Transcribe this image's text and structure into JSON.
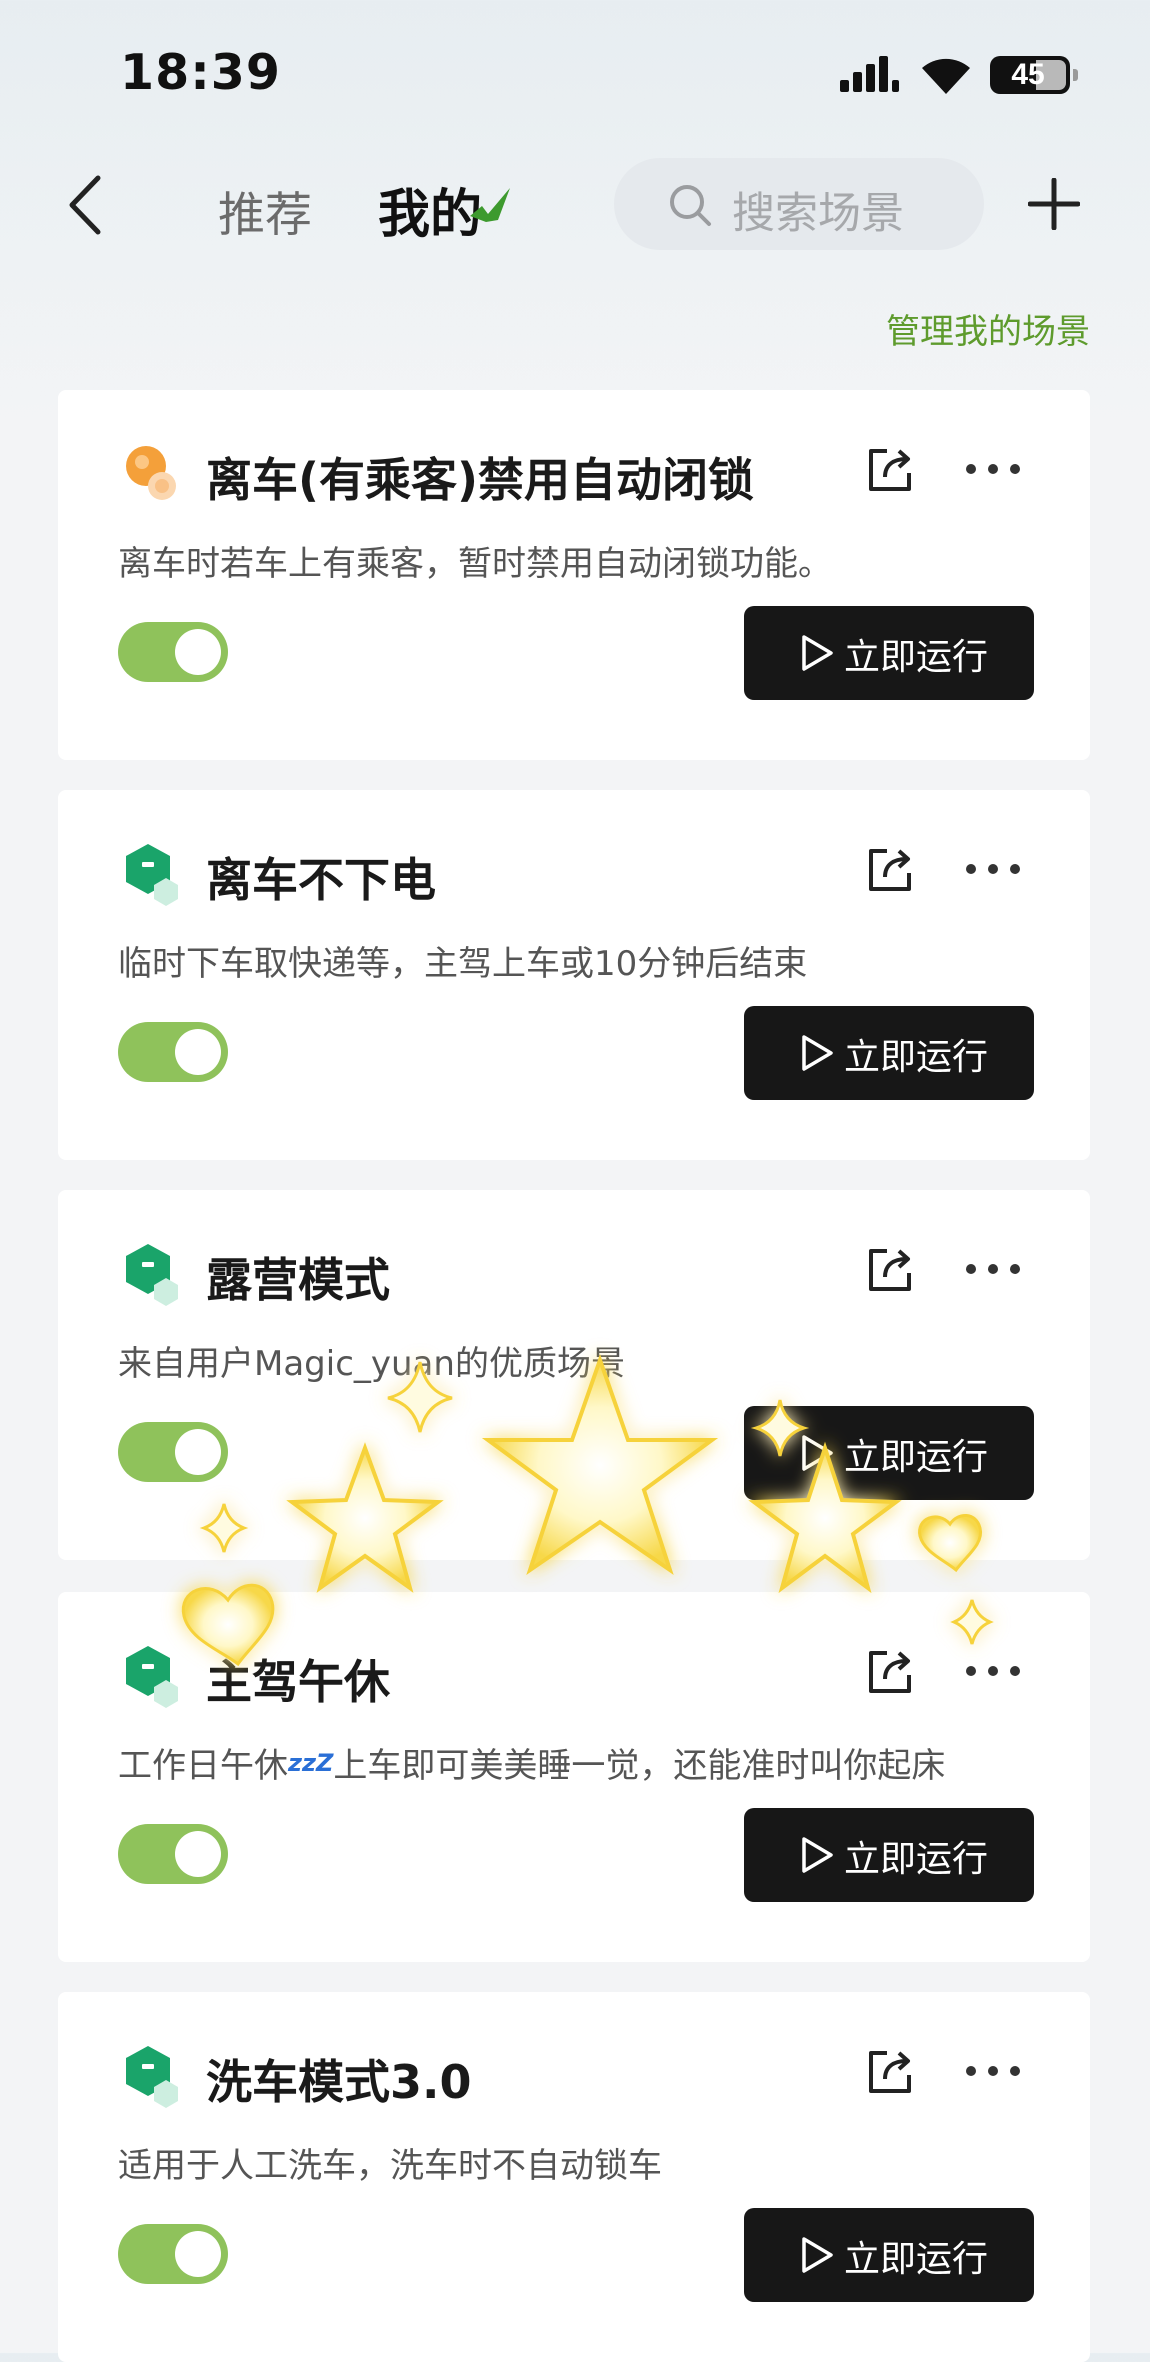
{
  "status": {
    "time": "18:39",
    "battery": "45"
  },
  "nav": {
    "tab_recommend": "推荐",
    "tab_mine": "我的",
    "search_placeholder": "搜索场景",
    "manage_label": "管理我的场景"
  },
  "colors": {
    "accent_green": "#5e9b2d",
    "toggle_on": "#8fc25b",
    "run_button": "#171717"
  },
  "scenes": [
    {
      "title": "离车(有乘客)禁用自动闭锁",
      "desc": "离车时若车上有乘客，暂时禁用自动闭锁功能。",
      "icon": "orange-bulb-icon",
      "enabled": true,
      "run_label": "立即运行"
    },
    {
      "title": "离车不下电",
      "desc": "临时下车取快递等，主驾上车或10分钟后结束",
      "icon": "green-cube-icon",
      "enabled": true,
      "run_label": "立即运行"
    },
    {
      "title": "露营模式",
      "desc": "来自用户Magic_yuan的优质场景",
      "icon": "green-cube-icon",
      "enabled": true,
      "run_label": "立即运行"
    },
    {
      "title": "主驾午休",
      "desc_a": "工作日午休",
      "desc_zzz": "zzZ",
      "desc_b": "上车即可美美睡一觉，还能准时叫你起床",
      "icon": "green-cube-icon",
      "enabled": true,
      "run_label": "立即运行"
    },
    {
      "title": "洗车模式3.0",
      "desc": "适用于人工洗车，洗车时不自动锁车",
      "icon": "green-cube-icon",
      "enabled": true,
      "run_label": "立即运行"
    }
  ]
}
